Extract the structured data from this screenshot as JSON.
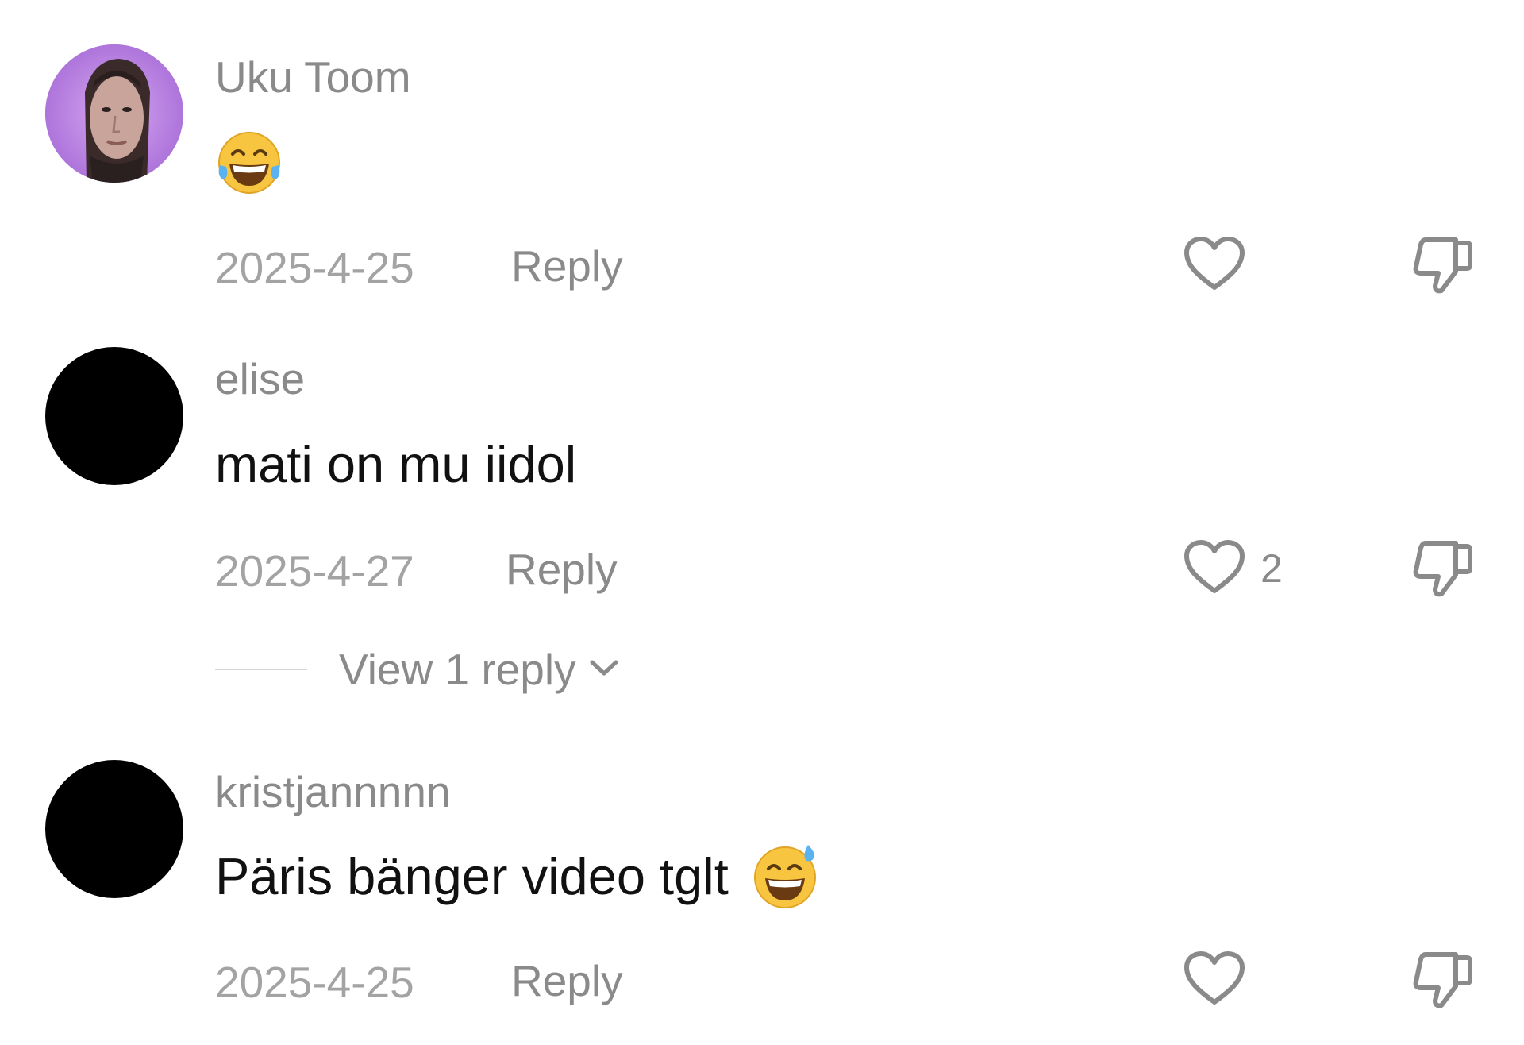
{
  "comments": [
    {
      "username": "Uku Toom",
      "text": "",
      "emoji": "face-with-tears-of-joy-emoji",
      "date": "2025-4-25",
      "reply_label": "Reply",
      "likes": ""
    },
    {
      "username": "elise",
      "text": "mati on mu iidol",
      "date": "2025-4-27",
      "reply_label": "Reply",
      "likes": "2",
      "view_replies": "View 1 reply"
    },
    {
      "username": "kristjannnnn",
      "text": "Päris bänger video tglt",
      "emoji": "grinning-face-with-sweat-emoji",
      "date": "2025-4-25",
      "reply_label": "Reply",
      "likes": ""
    }
  ],
  "icons": {
    "like": "heart-icon",
    "dislike": "thumbs-down-icon",
    "expand": "chevron-down-icon"
  },
  "colors": {
    "username": "#8a8a8a",
    "date": "#a3a3a3",
    "text": "#111111",
    "icon": "#8a8a8a",
    "avatar_bg_purple": "#b57be0"
  }
}
